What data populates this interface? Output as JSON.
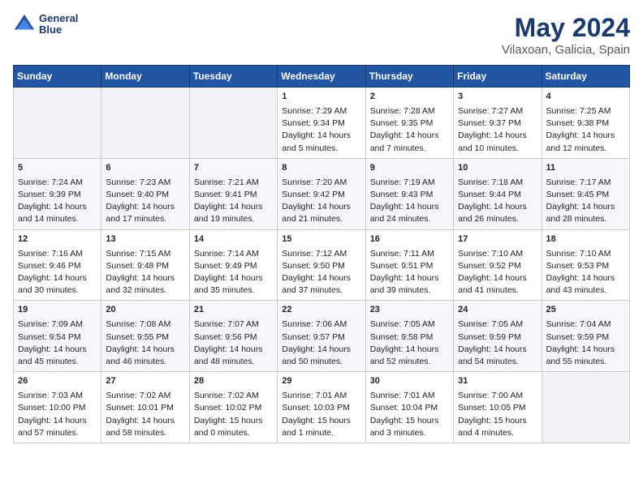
{
  "header": {
    "logo_line1": "General",
    "logo_line2": "Blue",
    "title": "May 2024",
    "subtitle": "Vilaxoan, Galicia, Spain"
  },
  "days_of_week": [
    "Sunday",
    "Monday",
    "Tuesday",
    "Wednesday",
    "Thursday",
    "Friday",
    "Saturday"
  ],
  "weeks": [
    {
      "cells": [
        {
          "day": "",
          "content": ""
        },
        {
          "day": "",
          "content": ""
        },
        {
          "day": "",
          "content": ""
        },
        {
          "day": "1",
          "content": "Sunrise: 7:29 AM\nSunset: 9:34 PM\nDaylight: 14 hours\nand 5 minutes."
        },
        {
          "day": "2",
          "content": "Sunrise: 7:28 AM\nSunset: 9:35 PM\nDaylight: 14 hours\nand 7 minutes."
        },
        {
          "day": "3",
          "content": "Sunrise: 7:27 AM\nSunset: 9:37 PM\nDaylight: 14 hours\nand 10 minutes."
        },
        {
          "day": "4",
          "content": "Sunrise: 7:25 AM\nSunset: 9:38 PM\nDaylight: 14 hours\nand 12 minutes."
        }
      ]
    },
    {
      "cells": [
        {
          "day": "5",
          "content": "Sunrise: 7:24 AM\nSunset: 9:39 PM\nDaylight: 14 hours\nand 14 minutes."
        },
        {
          "day": "6",
          "content": "Sunrise: 7:23 AM\nSunset: 9:40 PM\nDaylight: 14 hours\nand 17 minutes."
        },
        {
          "day": "7",
          "content": "Sunrise: 7:21 AM\nSunset: 9:41 PM\nDaylight: 14 hours\nand 19 minutes."
        },
        {
          "day": "8",
          "content": "Sunrise: 7:20 AM\nSunset: 9:42 PM\nDaylight: 14 hours\nand 21 minutes."
        },
        {
          "day": "9",
          "content": "Sunrise: 7:19 AM\nSunset: 9:43 PM\nDaylight: 14 hours\nand 24 minutes."
        },
        {
          "day": "10",
          "content": "Sunrise: 7:18 AM\nSunset: 9:44 PM\nDaylight: 14 hours\nand 26 minutes."
        },
        {
          "day": "11",
          "content": "Sunrise: 7:17 AM\nSunset: 9:45 PM\nDaylight: 14 hours\nand 28 minutes."
        }
      ]
    },
    {
      "cells": [
        {
          "day": "12",
          "content": "Sunrise: 7:16 AM\nSunset: 9:46 PM\nDaylight: 14 hours\nand 30 minutes."
        },
        {
          "day": "13",
          "content": "Sunrise: 7:15 AM\nSunset: 9:48 PM\nDaylight: 14 hours\nand 32 minutes."
        },
        {
          "day": "14",
          "content": "Sunrise: 7:14 AM\nSunset: 9:49 PM\nDaylight: 14 hours\nand 35 minutes."
        },
        {
          "day": "15",
          "content": "Sunrise: 7:12 AM\nSunset: 9:50 PM\nDaylight: 14 hours\nand 37 minutes."
        },
        {
          "day": "16",
          "content": "Sunrise: 7:11 AM\nSunset: 9:51 PM\nDaylight: 14 hours\nand 39 minutes."
        },
        {
          "day": "17",
          "content": "Sunrise: 7:10 AM\nSunset: 9:52 PM\nDaylight: 14 hours\nand 41 minutes."
        },
        {
          "day": "18",
          "content": "Sunrise: 7:10 AM\nSunset: 9:53 PM\nDaylight: 14 hours\nand 43 minutes."
        }
      ]
    },
    {
      "cells": [
        {
          "day": "19",
          "content": "Sunrise: 7:09 AM\nSunset: 9:54 PM\nDaylight: 14 hours\nand 45 minutes."
        },
        {
          "day": "20",
          "content": "Sunrise: 7:08 AM\nSunset: 9:55 PM\nDaylight: 14 hours\nand 46 minutes."
        },
        {
          "day": "21",
          "content": "Sunrise: 7:07 AM\nSunset: 9:56 PM\nDaylight: 14 hours\nand 48 minutes."
        },
        {
          "day": "22",
          "content": "Sunrise: 7:06 AM\nSunset: 9:57 PM\nDaylight: 14 hours\nand 50 minutes."
        },
        {
          "day": "23",
          "content": "Sunrise: 7:05 AM\nSunset: 9:58 PM\nDaylight: 14 hours\nand 52 minutes."
        },
        {
          "day": "24",
          "content": "Sunrise: 7:05 AM\nSunset: 9:59 PM\nDaylight: 14 hours\nand 54 minutes."
        },
        {
          "day": "25",
          "content": "Sunrise: 7:04 AM\nSunset: 9:59 PM\nDaylight: 14 hours\nand 55 minutes."
        }
      ]
    },
    {
      "cells": [
        {
          "day": "26",
          "content": "Sunrise: 7:03 AM\nSunset: 10:00 PM\nDaylight: 14 hours\nand 57 minutes."
        },
        {
          "day": "27",
          "content": "Sunrise: 7:02 AM\nSunset: 10:01 PM\nDaylight: 14 hours\nand 58 minutes."
        },
        {
          "day": "28",
          "content": "Sunrise: 7:02 AM\nSunset: 10:02 PM\nDaylight: 15 hours\nand 0 minutes."
        },
        {
          "day": "29",
          "content": "Sunrise: 7:01 AM\nSunset: 10:03 PM\nDaylight: 15 hours\nand 1 minute."
        },
        {
          "day": "30",
          "content": "Sunrise: 7:01 AM\nSunset: 10:04 PM\nDaylight: 15 hours\nand 3 minutes."
        },
        {
          "day": "31",
          "content": "Sunrise: 7:00 AM\nSunset: 10:05 PM\nDaylight: 15 hours\nand 4 minutes."
        },
        {
          "day": "",
          "content": ""
        }
      ]
    }
  ]
}
